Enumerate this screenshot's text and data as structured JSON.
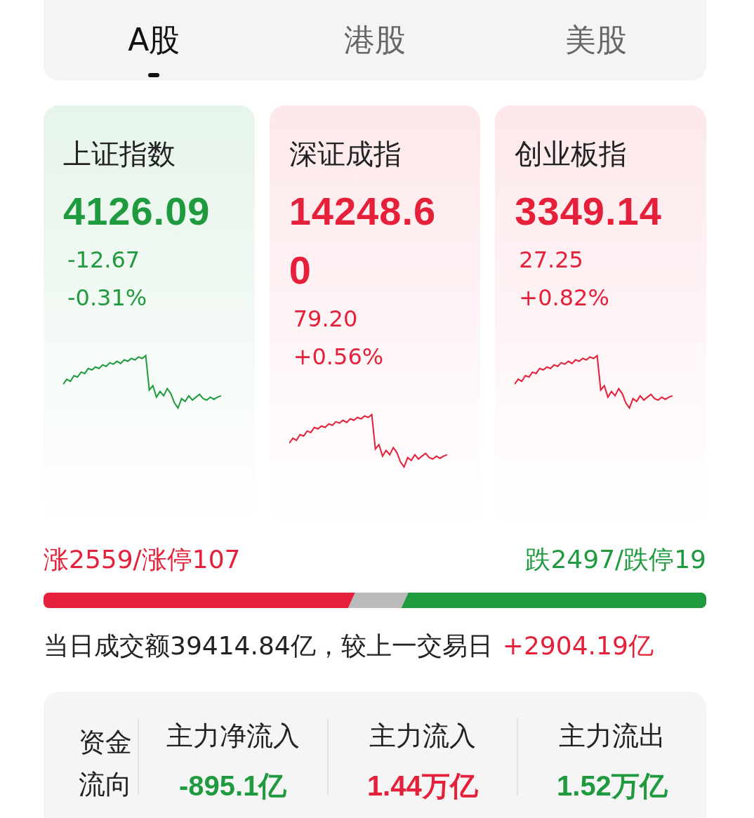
{
  "tabs": [
    {
      "label": "A股",
      "selected": true
    },
    {
      "label": "港股",
      "selected": false
    },
    {
      "label": "美股",
      "selected": false
    }
  ],
  "indices": [
    {
      "name": "上证指数",
      "value": "4126.09",
      "change": "-12.67",
      "percent": "-0.31%",
      "kind": "down"
    },
    {
      "name": "深证成指",
      "value": "14248.60",
      "change": "79.20",
      "percent": "+0.56%",
      "kind": "up"
    },
    {
      "name": "创业板指",
      "value": "3349.14",
      "change": "27.25",
      "percent": "+0.82%",
      "kind": "up"
    }
  ],
  "breadth": {
    "rise_text": "涨2559/涨停107",
    "fall_text": "跌2497/跌停19",
    "rise": {
      "level": 0.47
    },
    "fall": {
      "level": 0.46
    }
  },
  "turnover": {
    "text": "当日成交额39414.84亿，较上一交易日",
    "delta": "+2904.19亿"
  },
  "fund_flow": {
    "label": "资金流向",
    "items": [
      {
        "label": "主力净流入",
        "value": "-895.1亿",
        "kind": "down"
      },
      {
        "label": "主力流入",
        "value": "1.44万亿",
        "kind": "up"
      },
      {
        "label": "主力流出",
        "value": "1.52万亿",
        "kind": "down"
      }
    ]
  }
}
